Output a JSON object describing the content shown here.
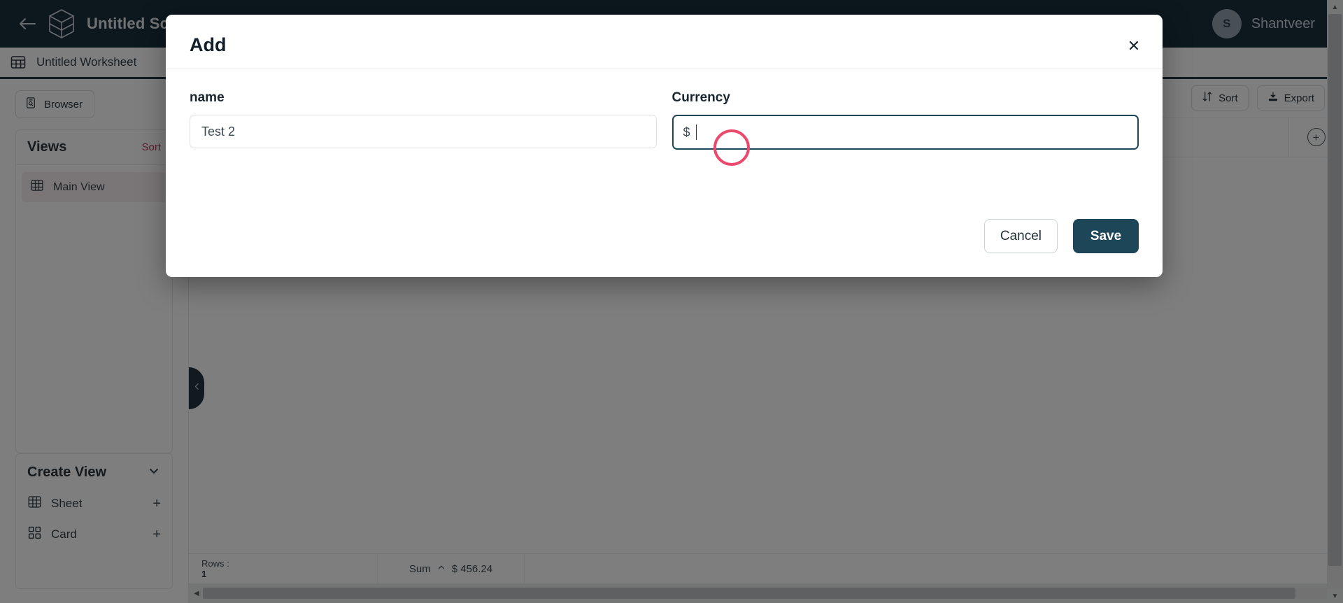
{
  "topbar": {
    "back_icon": "back-arrow-icon",
    "logo_icon": "cube-logo-icon",
    "schema_title": "Untitled Sche",
    "user": {
      "initial": "S",
      "name": "Shantveer"
    }
  },
  "sheetbar": {
    "worksheet_icon": "grid-icon",
    "worksheet_name": "Untitled Worksheet"
  },
  "sidebar": {
    "browser_button": "Browser",
    "views": {
      "title": "Views",
      "sort_label": "Sort",
      "items": [
        {
          "label": "Main View",
          "icon": "grid-icon"
        }
      ]
    },
    "create_view": {
      "title": "Create View",
      "chevron_icon": "chevron-down-icon",
      "items": [
        {
          "label": "Sheet",
          "icon": "grid-icon",
          "action": "+"
        },
        {
          "label": "Card",
          "icon": "card-grid-icon",
          "action": "+"
        }
      ]
    }
  },
  "content_toolbar": {
    "sort_label": "Sort",
    "sort_icon": "sort-icon",
    "export_label": "Export",
    "export_icon": "download-icon",
    "add_column_icon": "circle-plus-icon"
  },
  "collapse_handle": {
    "icon": "chevron-left-icon"
  },
  "statusbar": {
    "rows_label": "Rows :",
    "rows_count": "1",
    "sum_label": "Sum",
    "sum_caret_icon": "chevron-up-icon",
    "sum_value": "$ 456.24"
  },
  "scrollbars": {
    "h_left_icon": "triangle-left-icon",
    "h_right_icon": "triangle-right-icon",
    "v_up_icon": "triangle-up-icon",
    "v_down_icon": "triangle-down-icon"
  },
  "modal": {
    "title": "Add",
    "close_icon": "close-icon",
    "fields": [
      {
        "label": "name",
        "value": "Test 2",
        "placeholder": "Test 2",
        "focused": false
      },
      {
        "label": "Currency",
        "prefix": "$",
        "value": "",
        "placeholder": "",
        "focused": true
      }
    ],
    "cancel_label": "Cancel",
    "save_label": "Save"
  },
  "annotation": {
    "type": "click-ring",
    "color": "#ec4a6d"
  },
  "colors": {
    "topbar_bg": "#041c2c",
    "accent_dark": "#1d4659",
    "sort_link": "#a62c48",
    "ring": "#ec4a6d",
    "selected_row": "#f6eef0"
  }
}
